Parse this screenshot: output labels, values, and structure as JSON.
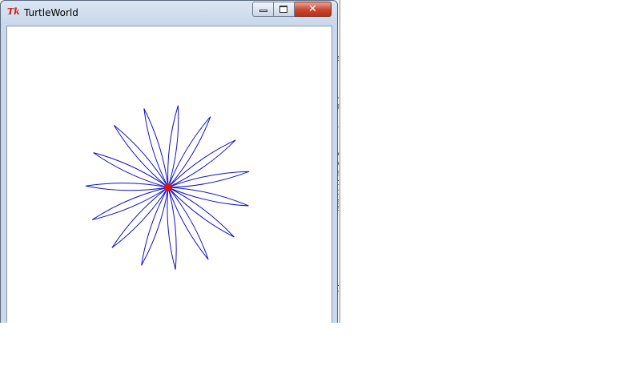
{
  "window": {
    "title": "TurtleWorld",
    "icon": "tk-feather-icon",
    "app_icon_text": "Tk",
    "controls": {
      "minimize_icon": "minimize-icon",
      "maximize_icon": "maximize-icon",
      "close_icon": "close-icon",
      "close_glyph": "✕"
    }
  },
  "background_window": {
    "visible_fragments": [
      "e",
      "u",
      "a",
      "r",
      "v",
      "v",
      "e",
      "c",
      "c",
      "e",
      "e",
      "D"
    ]
  },
  "drawing": {
    "shape": "flower",
    "petal_count": 15,
    "petal_color": "#1010c8",
    "turtle_color": "#e01010",
    "turtle_marker": "turtle-icon"
  }
}
